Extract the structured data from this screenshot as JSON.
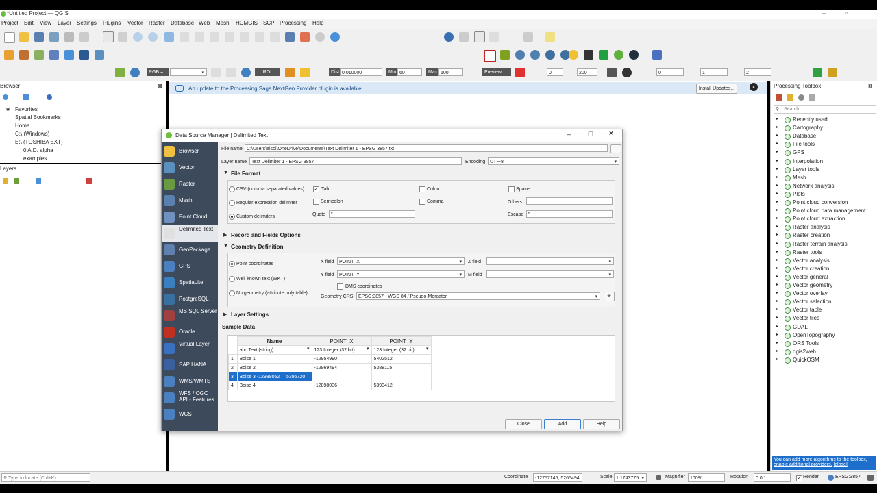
{
  "window": {
    "title": "*Untitled Project — QGIS"
  },
  "menus": [
    "Project",
    "Edit",
    "View",
    "Layer",
    "Settings",
    "Plugins",
    "Vector",
    "Raster",
    "Database",
    "Web",
    "Mesh",
    "HCMGIS",
    "SCP",
    "Processing",
    "Help"
  ],
  "toolbar3": {
    "rgb": "RGB =",
    "roi": "ROI",
    "dist_label": "Dist",
    "dist_value": "0.010000",
    "min_label": "Min",
    "min_value": "60",
    "max_label": "Max",
    "max_value": "100",
    "preview": "Preview",
    "spin1": "0",
    "spin2": "200",
    "spin3": "0",
    "spin4": "1",
    "spin5": "2"
  },
  "browser": {
    "title": "Browser",
    "items": [
      "Favorites",
      "Spatial Bookmarks",
      "Home",
      "C:\\ (Windows)",
      "E:\\ (TOSHIBA EXT)",
      "0 A.D. alpha",
      "examples"
    ]
  },
  "layers": {
    "title": "Layers"
  },
  "infobar": {
    "message": "An update to the Processing Saga NextGen Provider plugin is available",
    "button": "Install Updates..."
  },
  "toolbox": {
    "title": "Processing Toolbox",
    "search_placeholder": "Search...",
    "items": [
      "Recently used",
      "Cartography",
      "Database",
      "File tools",
      "GPS",
      "Interpolation",
      "Layer tools",
      "Mesh",
      "Network analysis",
      "Plots",
      "Point cloud conversion",
      "Point cloud data management",
      "Point cloud extraction",
      "Raster analysis",
      "Raster creation",
      "Raster terrain analysis",
      "Raster tools",
      "Vector analysis",
      "Vector creation",
      "Vector general",
      "Vector geometry",
      "Vector overlay",
      "Vector selection",
      "Vector table",
      "Vector tiles",
      "GDAL",
      "OpenTopography",
      "ORS Tools",
      "qgis2web",
      "QuickOSM"
    ],
    "hint": "You can add more algorithms to the toolbox,",
    "hint_link": "enable additional providers.",
    "hint_close": "[close]"
  },
  "statusbar": {
    "locate_placeholder": "Type to locate (Ctrl+K)",
    "coordinate_label": "Coordinate",
    "coordinate": "-12757145, 5265494",
    "scale_label": "Scale",
    "scale": "1:1743775",
    "magnifier_label": "Magnifier",
    "magnifier": "100%",
    "rotation_label": "Rotation",
    "rotation": "0.0 °",
    "render_label": "Render",
    "crs": "EPSG:3857"
  },
  "dialog": {
    "title": "Data Source Manager | Delimited Text",
    "sidebar": [
      "Browser",
      "Vector",
      "Raster",
      "Mesh",
      "Point Cloud",
      "Delimited Text",
      "GeoPackage",
      "GPS",
      "SpatiaLite",
      "PostgreSQL",
      "MS SQL Server",
      "Oracle",
      "Virtual Layer",
      "SAP HANA",
      "WMS/WMTS",
      "WFS / OGC API - Features",
      "WCS"
    ],
    "file_name_label": "File name",
    "file_name": "C:\\Users\\alsol\\OneDrive\\Documents\\Text Delimiter 1 - EPSG 3857.txt",
    "layer_name_label": "Layer name",
    "layer_name": "Text Delimiter 1 - EPSG 3857",
    "encoding_label": "Encoding",
    "encoding": "UTF-8",
    "file_format": {
      "title": "File Format",
      "opt_csv": "CSV (comma separated values)",
      "opt_regex": "Regular expression delimiter",
      "opt_custom": "Custom delimiters",
      "tab": "Tab",
      "colon": "Colon",
      "space": "Space",
      "semicolon": "Semicolon",
      "comma": "Comma",
      "others": "Others",
      "quote_label": "Quote",
      "quote": "\"",
      "escape_label": "Escape",
      "escape": "\""
    },
    "record_options": "Record and Fields Options",
    "geometry": {
      "title": "Geometry Definition",
      "opt_point": "Point coordinates",
      "opt_wkt": "Well known text (WKT)",
      "opt_none": "No geometry (attribute only table)",
      "x_label": "X field",
      "x_value": "POINT_X",
      "y_label": "Y field",
      "y_value": "POINT_Y",
      "z_label": "Z field",
      "m_label": "M field",
      "dms": "DMS coordinates",
      "crs_label": "Geometry CRS",
      "crs_value": "EPSG:3857 - WGS 84 / Pseudo-Mercator"
    },
    "layer_settings": "Layer Settings",
    "sample_data": "Sample Data",
    "table": {
      "headers": [
        "Name",
        "POINT_X",
        "POINT_Y"
      ],
      "types": [
        "abc Text (string)",
        "123 Integer (32 bit)",
        "123 Integer (32 bit)"
      ],
      "rows": [
        [
          "1",
          "Boise 1",
          "-12954990",
          "5402512"
        ],
        [
          "2",
          "Boise 2",
          "-12969494",
          "5388115"
        ],
        [
          "3",
          "Boise 3 -12938052     5396720",
          "",
          ""
        ],
        [
          "4",
          "Boise 4",
          "-12898036",
          "5393412"
        ]
      ]
    },
    "buttons": {
      "close": "Close",
      "add": "Add",
      "help": "Help"
    }
  }
}
